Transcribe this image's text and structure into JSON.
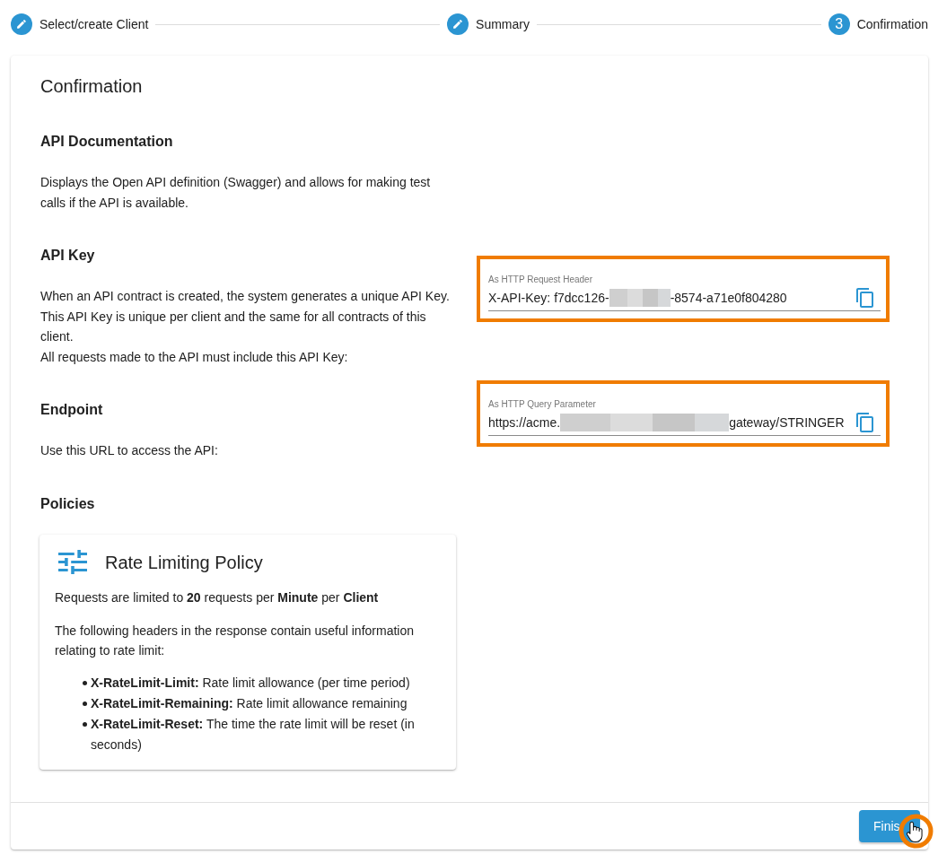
{
  "stepper": {
    "steps": [
      {
        "label": "Select/create Client",
        "completed": true
      },
      {
        "label": "Summary",
        "completed": true
      },
      {
        "label": "Confirmation",
        "completed": false,
        "number": "3"
      }
    ]
  },
  "card": {
    "title": "Confirmation",
    "sections": [
      {
        "heading": "API Documentation",
        "paragraphs": [
          "Displays the Open API definition (Swagger) and allows for making test calls if the API is available."
        ]
      },
      {
        "heading": "API Key",
        "paragraphs": [
          "When an API contract is created, the system generates a unique API Key. This API Key is unique per client and the same for all contracts of this client.",
          "All requests made to the API must include this API Key:"
        ],
        "field": {
          "label": "As HTTP Request Header",
          "value_start": "X-API-Key: f7dcc126-",
          "value_end": "-8574-a71e0f804280",
          "redacted": true,
          "highlighted": true
        }
      },
      {
        "heading": "Endpoint",
        "paragraphs": [
          "Use this URL to access the API:"
        ],
        "field": {
          "label": "As HTTP Query Parameter",
          "value_start": "https://acme.",
          "value_end": "gateway/STRINGER",
          "redacted": true,
          "highlighted": true
        }
      },
      {
        "heading": "Policies",
        "policies": [
          {
            "title": "Rate Limiting Policy",
            "summary": "Requests are limited to **20** requests per **Minute** per **Client**",
            "intro": "The following headers in the response contain useful information relating to rate limit:",
            "headers": [
              "**X-RateLimit-Limit:** Rate limit allowance (per time period)",
              "**X-RateLimit-Remaining:** Rate limit allowance remaining",
              "**X-RateLimit-Reset:** The time the rate limit will be reset (in seconds)"
            ]
          }
        ]
      }
    ],
    "finish_button": {
      "label": "Finis",
      "click_highlight": true
    }
  }
}
